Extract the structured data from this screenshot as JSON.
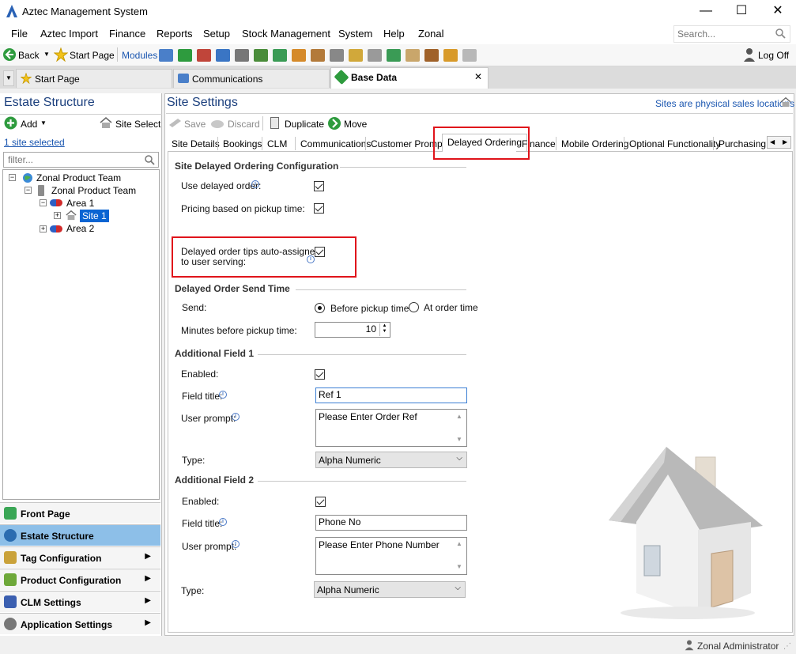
{
  "window": {
    "title": "Aztec Management System",
    "minimize": "—",
    "maximize": "☐",
    "close": "✕"
  },
  "menu": [
    "File",
    "Aztec Import",
    "Finance",
    "Reports",
    "Setup",
    "Stock Management",
    "System",
    "Help",
    "Zonal"
  ],
  "search": {
    "placeholder": "Search...",
    "value": ""
  },
  "toolbar": {
    "back": "Back",
    "start_page": "Start Page",
    "modules": "Modules",
    "log_off": "Log Off"
  },
  "doc_tabs": [
    {
      "label": "Start Page"
    },
    {
      "label": "Communications"
    },
    {
      "label": "Base Data",
      "close": "✕"
    }
  ],
  "left": {
    "title": "Estate Structure",
    "add": "Add",
    "site_select": "Site Select",
    "selected_link": "1 site selected",
    "filter_placeholder": "filter...",
    "tree": [
      "Zonal Product Team",
      "Zonal Product Team",
      "Area 1",
      "Site 1",
      "Area 2"
    ],
    "nav": [
      {
        "label": "Front Page",
        "color": "#3aa655"
      },
      {
        "label": "Estate Structure",
        "color": "#2b6cb0"
      },
      {
        "label": "Tag Configuration",
        "color": "#caa23a"
      },
      {
        "label": "Product Configuration",
        "color": "#6ea83a"
      },
      {
        "label": "CLM Settings",
        "color": "#3b5fb0"
      },
      {
        "label": "Application Settings",
        "color": "#777777"
      }
    ]
  },
  "main": {
    "title": "Site Settings",
    "subtitle": "Sites are physical sales locations",
    "actions": {
      "save": "Save",
      "discard": "Discard",
      "duplicate": "Duplicate",
      "move": "Move"
    },
    "tabs": [
      "Site Details",
      "Bookings",
      "CLM",
      "Communications",
      "Customer Prompts",
      "Delayed Ordering",
      "Finance",
      "Mobile Ordering",
      "Optional Functionality",
      "Purchasing"
    ],
    "sections": {
      "config": "Site Delayed Ordering Configuration",
      "send_time": "Delayed Order Send Time",
      "field1": "Additional Field 1",
      "field2": "Additional Field 2"
    },
    "labels": {
      "use_delayed": "Use delayed order:",
      "pricing": "Pricing based on pickup time:",
      "tips": "Delayed order tips auto-assigned\nto user serving:",
      "send": "Send:",
      "before_pickup": "Before pickup time",
      "at_order": "At order time",
      "minutes": "Minutes before pickup time:",
      "enabled": "Enabled:",
      "field_title": "Field title:",
      "user_prompt": "User prompt:",
      "type": "Type:"
    },
    "values": {
      "minutes": "10",
      "f1_title": "Ref 1",
      "f1_prompt": "Please Enter Order Ref",
      "f1_type": "Alpha Numeric",
      "f2_title": "Phone No",
      "f2_prompt": "Please Enter Phone Number",
      "f2_type": "Alpha Numeric"
    }
  },
  "status": {
    "user": "Zonal Administrator"
  }
}
